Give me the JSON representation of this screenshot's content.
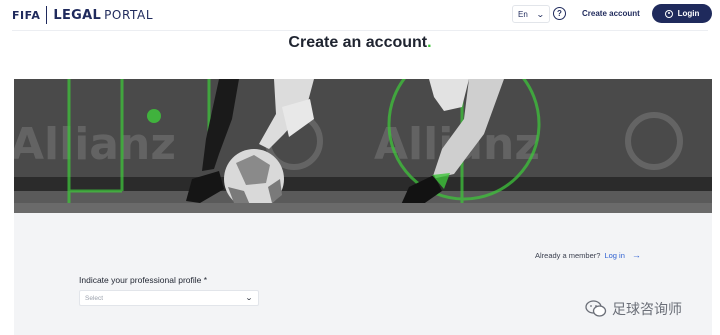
{
  "header": {
    "logo_fifa": "FIFA",
    "logo_legal": "LEGAL",
    "logo_portal": "PORTAL",
    "language": "En",
    "help_symbol": "?",
    "create_account_link": "Create account",
    "login_button": "Login"
  },
  "page": {
    "title": "Create an account",
    "title_dot": "."
  },
  "banner": {
    "background_text_left": "Allianz",
    "background_text_right": "Allianz",
    "accent_color": "#3ec43b"
  },
  "form": {
    "already_member_text": "Already a member?",
    "login_link": "Log in",
    "profile_label": "Indicate your professional profile *",
    "profile_select_placeholder": "Select"
  },
  "watermark": {
    "text": "足球咨询师"
  },
  "colors": {
    "brand_navy": "#1f2a5c",
    "accent_green": "#3ec43b",
    "link_blue": "#2d5fd1",
    "form_background": "#f3f4f6"
  }
}
